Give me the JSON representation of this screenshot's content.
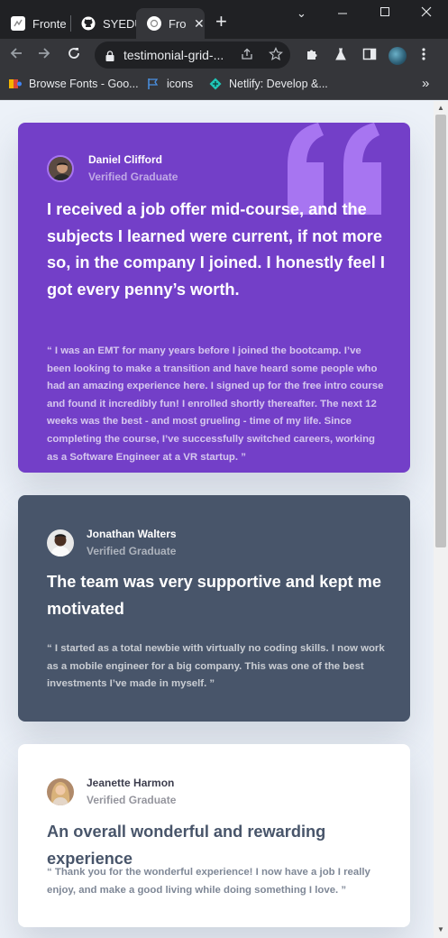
{
  "browser": {
    "tabs": [
      {
        "title": "Fronte",
        "active": false
      },
      {
        "title": "SYEDU",
        "active": false
      },
      {
        "title": "Fro",
        "active": true
      }
    ],
    "url": "testimonial-grid-...",
    "bookmarks": [
      {
        "label": "Browse Fonts - Goo..."
      },
      {
        "label": "icons"
      },
      {
        "label": "Netlify: Develop &..."
      }
    ],
    "overflow_label": "»"
  },
  "testimonials": [
    {
      "name": "Daniel Clifford",
      "status": "Verified Graduate",
      "headline": "I received a job offer mid-course, and the subjects I learned were current, if not more so, in the company I joined. I honestly feel I got every penny’s worth.",
      "body": "“ I was an EMT for many years before I joined the bootcamp. I’ve been looking to make a transition and have heard some people who had an amazing experience here. I signed up for the free intro course and found it incredibly fun! I enrolled shortly thereafter. The next 12 weeks was the best - and most grueling - time of my life. Since completing the course, I’ve successfully switched careers, working as a Software Engineer at a VR startup. ”",
      "color": "#733FC8"
    },
    {
      "name": "Jonathan Walters",
      "status": "Verified Graduate",
      "headline": "The team was very supportive and kept me motivated",
      "body": "“ I started as a total newbie with virtually no coding skills. I now work as a mobile engineer for a big company. This was one of the best investments I’ve made in myself. ”",
      "color": "#48556A"
    },
    {
      "name": "Jeanette Harmon",
      "status": "Verified Graduate",
      "headline": "An overall wonderful and rewarding experience",
      "body": "“ Thank you for the wonderful experience! I now have a job I really enjoy, and make a good living while doing something I love. ”",
      "color": "#FFFFFF"
    }
  ]
}
